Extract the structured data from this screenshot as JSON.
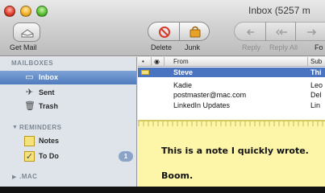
{
  "window": {
    "title": "Inbox (5257 m"
  },
  "toolbar": {
    "get_mail": "Get Mail",
    "delete": "Delete",
    "junk": "Junk",
    "reply": "Reply",
    "reply_all": "Reply All",
    "forward": "Fo"
  },
  "sidebar": {
    "mailboxes_header": "MAILBOXES",
    "mailboxes": [
      {
        "label": "Inbox",
        "icon": "inbox-icon"
      },
      {
        "label": "Sent",
        "icon": "sent-icon"
      },
      {
        "label": "Trash",
        "icon": "trash-icon"
      }
    ],
    "reminders_header": "REMINDERS",
    "reminders": [
      {
        "label": "Notes",
        "icon": "notes-icon"
      },
      {
        "label": "To Do",
        "icon": "todo-icon",
        "badge": "1"
      }
    ],
    "mac_header": ".MAC"
  },
  "message_list": {
    "columns": [
      "•",
      "◉",
      "From",
      "Sub"
    ],
    "rows": [
      {
        "from": "Steve",
        "subject": "Thi",
        "selected": true
      },
      {
        "from": "Kadie",
        "subject": "Leo"
      },
      {
        "from": "postmaster@mac.com",
        "subject": "Del"
      },
      {
        "from": "LinkedIn Updates",
        "subject": "Lin"
      }
    ]
  },
  "note": {
    "line1": "This is a note I quickly wrote.",
    "line2": "Boom."
  },
  "colors": {
    "selection": "#4a73c0",
    "sidebar_bg": "#dfe4ea",
    "note_bg": "#fdf6a8"
  }
}
